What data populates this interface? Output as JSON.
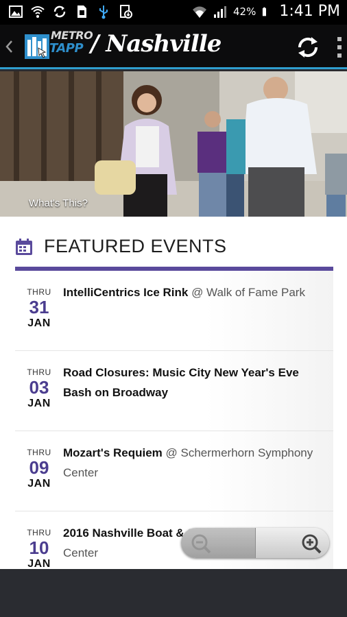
{
  "status_bar": {
    "battery_percent": "42%",
    "time": "1:41 PM",
    "icons": [
      "image-icon",
      "wifi-hotspot-icon",
      "sync-icon",
      "sim-icon",
      "usb-icon",
      "download-icon",
      "wifi-icon",
      "signal-icon",
      "battery-icon"
    ]
  },
  "action_bar": {
    "logo_line1": "METRO",
    "logo_line2": "TAPP",
    "city_title": "/ Nashville"
  },
  "hero": {
    "whats_this": "What's This?"
  },
  "featured": {
    "title": "FEATURED EVENTS",
    "events": [
      {
        "pre": "THRU",
        "day": "31",
        "month": "JAN",
        "title": "IntelliCentrics Ice Rink",
        "venue": "@ Walk of Fame Park"
      },
      {
        "pre": "THRU",
        "day": "03",
        "month": "JAN",
        "title": "Road Closures: Music City New Year's Eve Bash on Broadway",
        "venue": ""
      },
      {
        "pre": "THRU",
        "day": "09",
        "month": "JAN",
        "title": "Mozart's Requiem",
        "venue": "@ Schermerhorn Symphony Center"
      },
      {
        "pre": "THRU",
        "day": "10",
        "month": "JAN",
        "title": "2016 Nashville Boat & Sportshow",
        "venue": "@ Music City Center"
      }
    ]
  },
  "colors": {
    "accent_purple": "#4b3d8f",
    "action_bar_line": "#2f9fd0"
  }
}
